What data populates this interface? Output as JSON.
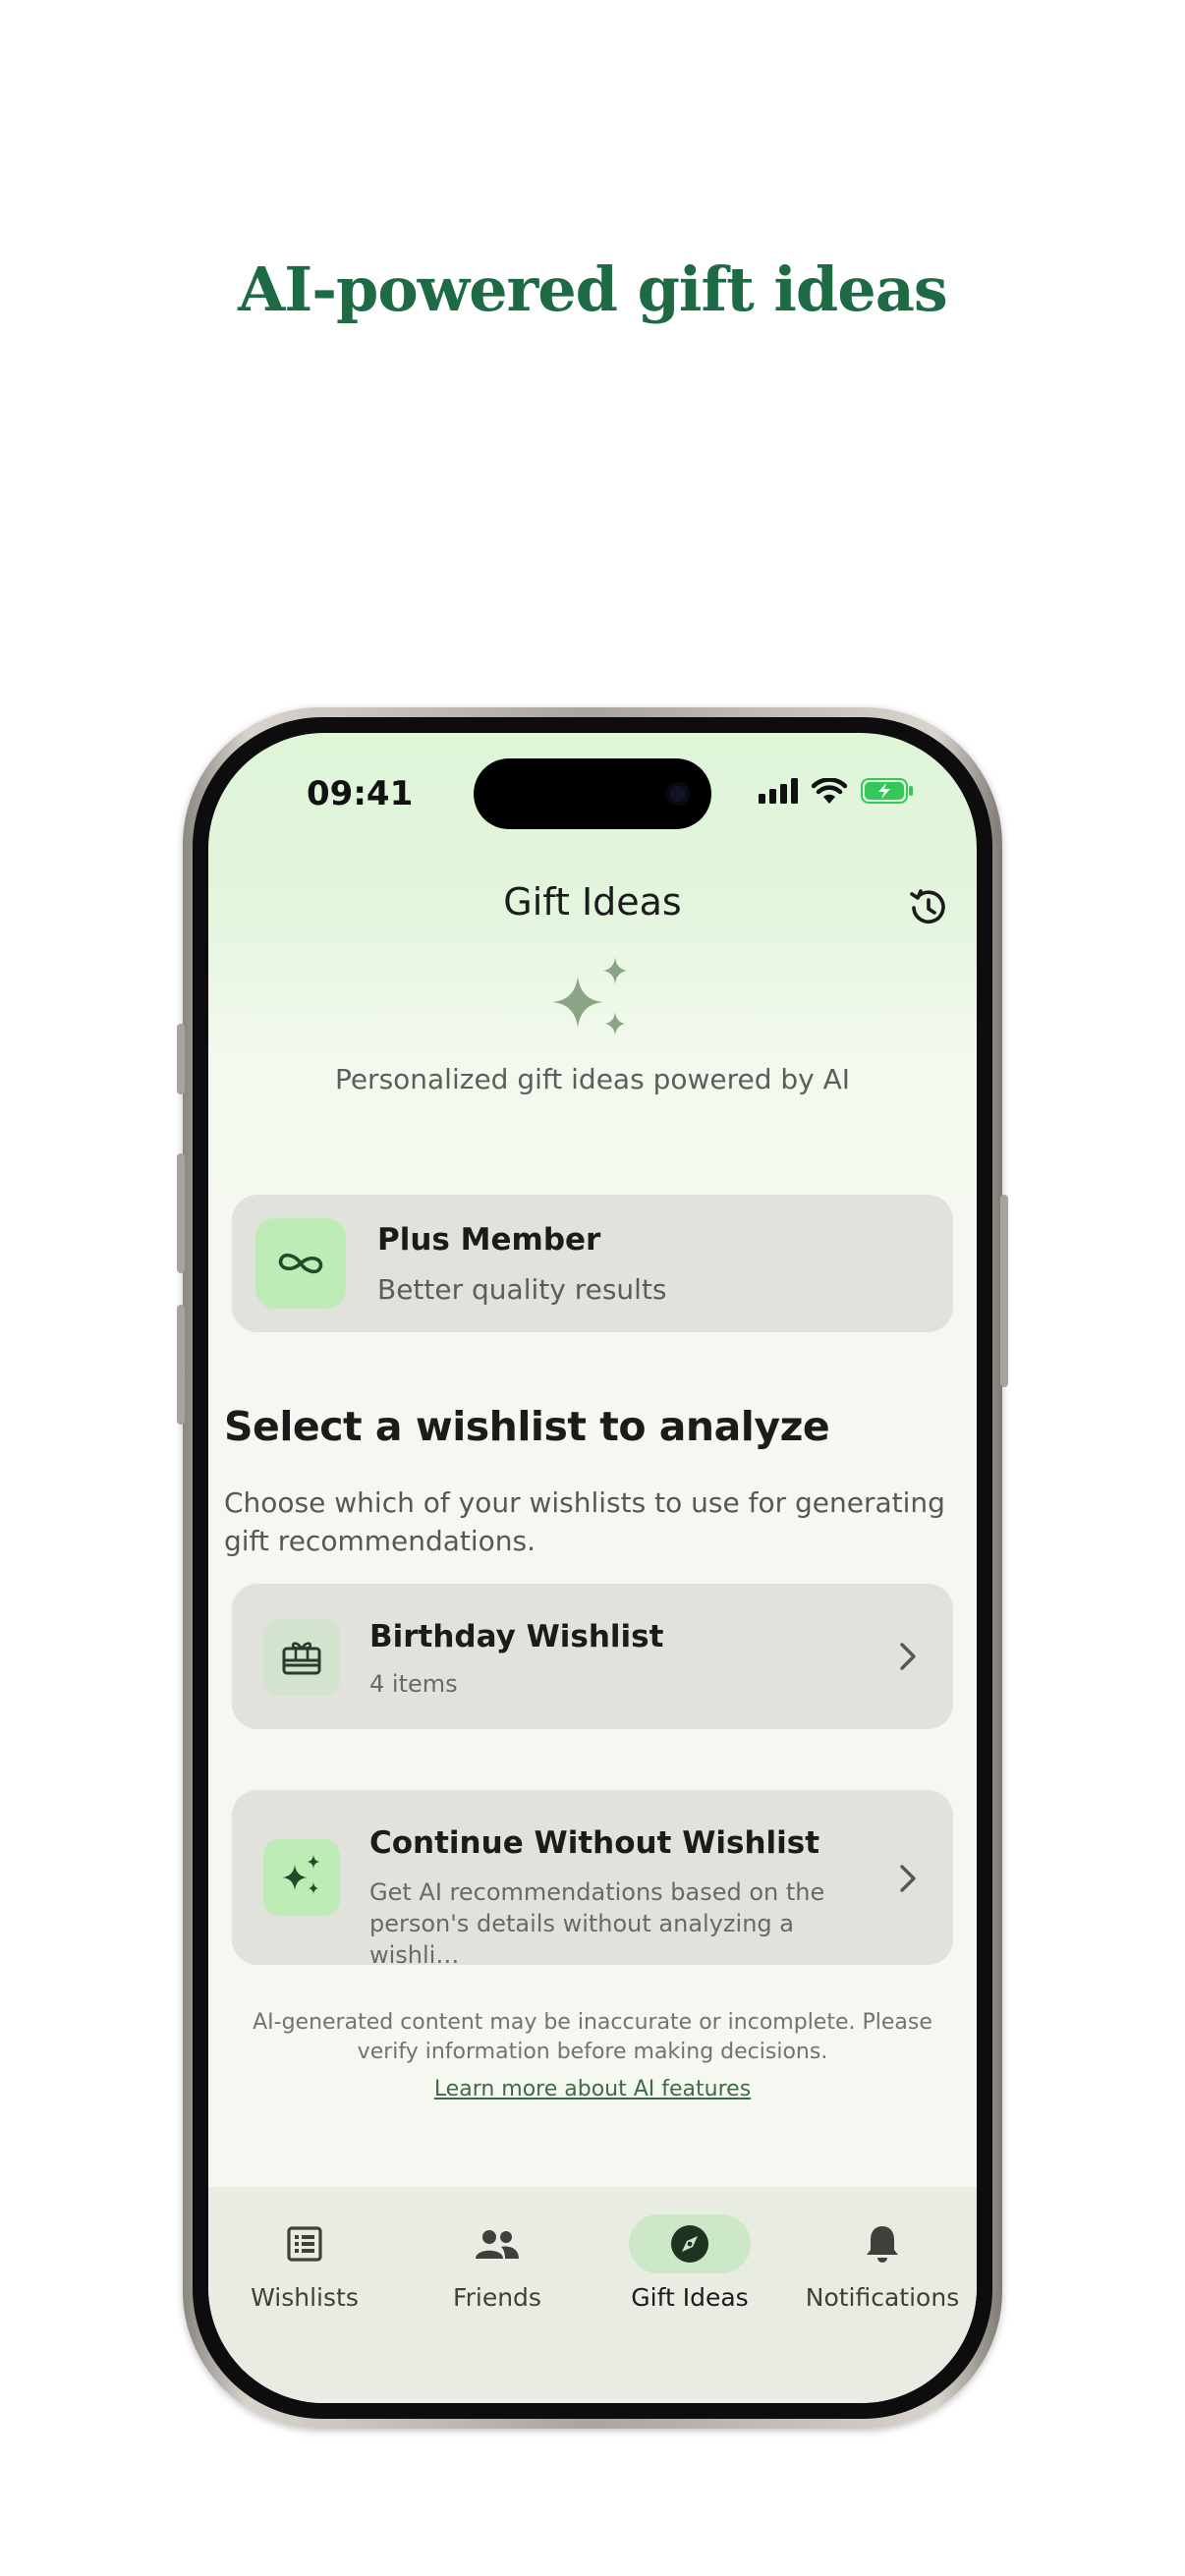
{
  "headline": "AI-powered gift ideas",
  "status_bar": {
    "time": "09:41"
  },
  "nav": {
    "title": "Gift Ideas",
    "history_icon": "history-icon"
  },
  "hero": {
    "icon": "sparkles-icon",
    "subtitle": "Personalized gift ideas powered by AI"
  },
  "membership": {
    "icon": "infinity-icon",
    "title": "Plus Member",
    "subtitle": "Better quality results"
  },
  "section": {
    "heading": "Select a wishlist to analyze",
    "description": "Choose which of your wishlists to use for generating gift recommendations."
  },
  "wishlists": [
    {
      "icon": "gift-card-icon",
      "title": "Birthday Wishlist",
      "subtitle": "4 items"
    }
  ],
  "continue_option": {
    "icon": "sparkles-icon",
    "title": "Continue Without Wishlist",
    "subtitle": "Get AI recommendations based on the person's details without analyzing a wishli…"
  },
  "disclaimer": {
    "text": "AI-generated content may be inaccurate or incomplete. Please verify information before making decisions.",
    "link": "Learn more about AI features"
  },
  "tabs": [
    {
      "label": "Wishlists",
      "icon": "list-icon",
      "active": false
    },
    {
      "label": "Friends",
      "icon": "people-icon",
      "active": false
    },
    {
      "label": "Gift Ideas",
      "icon": "compass-icon",
      "active": true
    },
    {
      "label": "Notifications",
      "icon": "bell-icon",
      "active": false
    }
  ],
  "colors": {
    "headline": "#1d6a45",
    "accent_green": "#bdecb7",
    "card_bg": "#e0e2db",
    "tabbar_bg": "#e9ece3"
  }
}
